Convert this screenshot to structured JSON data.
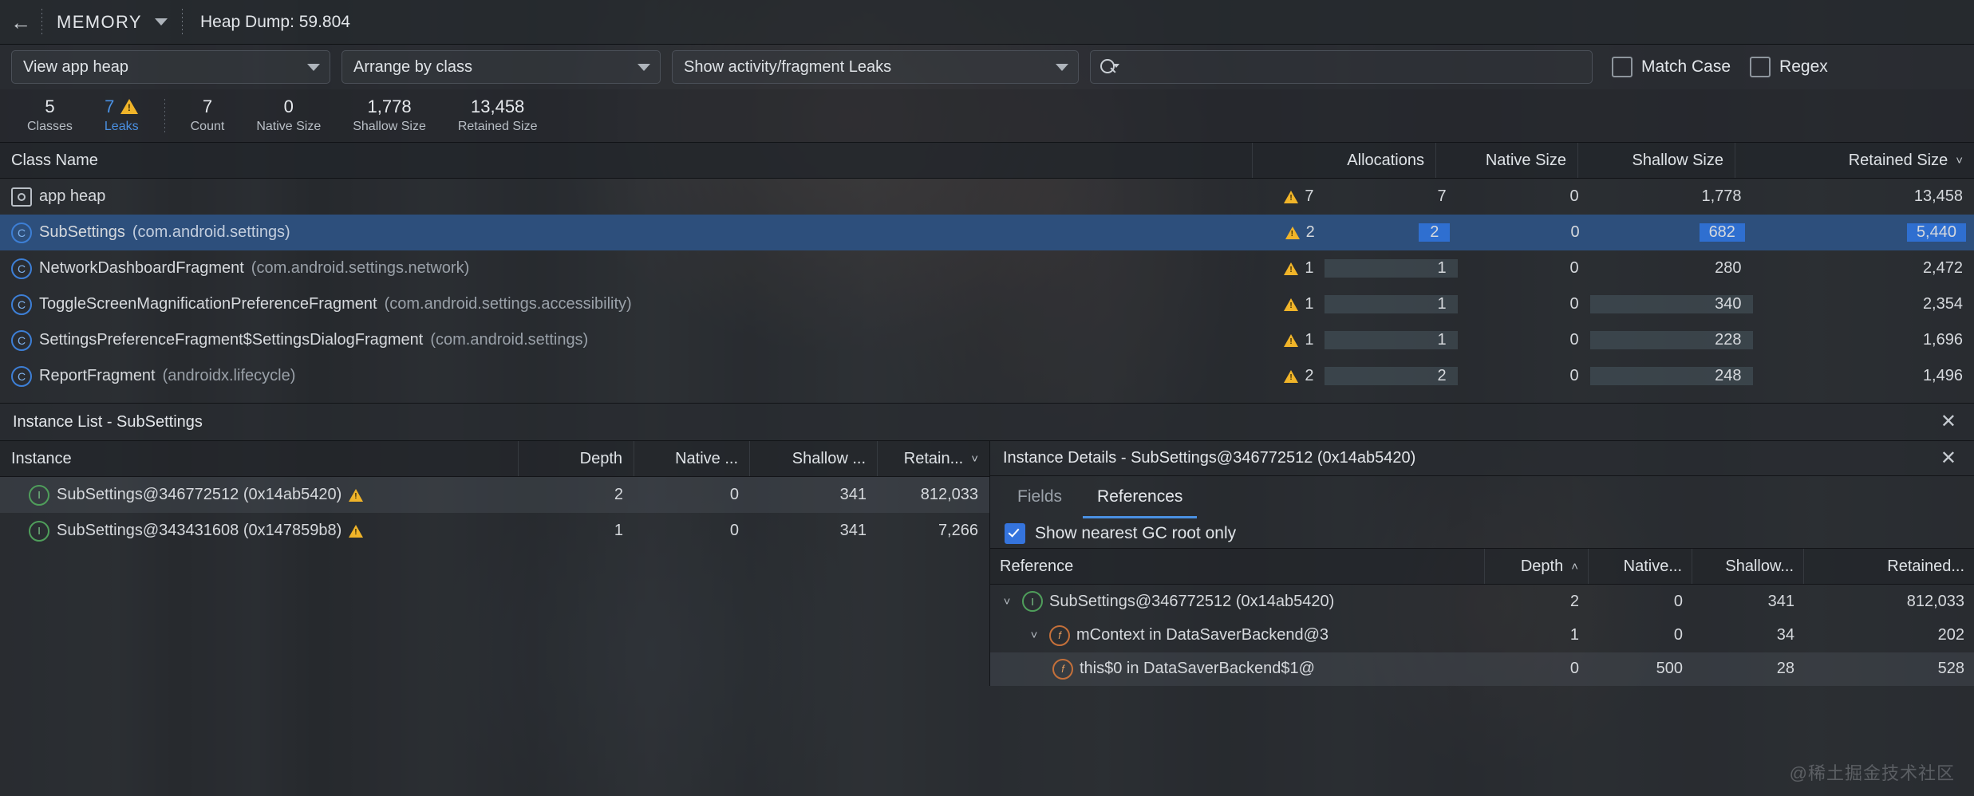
{
  "topbar": {
    "back_icon": "back-arrow-icon",
    "tool_name": "MEMORY",
    "dropdown_icon": "chevron-down-icon",
    "session_label": "Heap Dump: 59.804"
  },
  "filterbar": {
    "view_heap": "View app heap",
    "arrange_by": "Arrange by class",
    "leaks_filter": "Show activity/fragment Leaks",
    "search": {
      "value": "",
      "placeholder": "",
      "icon": "search-icon"
    },
    "match_case": {
      "label": "Match Case",
      "checked": false
    },
    "regex": {
      "label": "Regex",
      "checked": false
    }
  },
  "stats": [
    {
      "value": "5",
      "label": "Classes",
      "warn": false,
      "accent": false
    },
    {
      "value": "7",
      "label": "Leaks",
      "warn": true,
      "accent": true
    },
    {
      "value": "7",
      "label": "Count",
      "warn": false,
      "accent": false
    },
    {
      "value": "0",
      "label": "Native Size",
      "warn": false,
      "accent": false
    },
    {
      "value": "1,778",
      "label": "Shallow Size",
      "warn": false,
      "accent": false
    },
    {
      "value": "13,458",
      "label": "Retained Size",
      "warn": false,
      "accent": false
    }
  ],
  "class_table": {
    "columns": [
      "Class Name",
      "Allocations",
      "Native Size",
      "Shallow Size",
      "Retained Size"
    ],
    "sorted_column": "Retained Size",
    "sort_direction": "desc",
    "sort_icon": "chevron-down-icon",
    "rows": [
      {
        "icon": "folder-icon",
        "name": "app heap",
        "pkg": "",
        "leaks": "7",
        "allocations": "7",
        "native": "0",
        "shallow": "1,778",
        "retained": "13,458",
        "selected": false
      },
      {
        "icon": "class-icon",
        "name": "SubSettings",
        "pkg": "(com.android.settings)",
        "leaks": "2",
        "allocations": "2",
        "native": "0",
        "shallow": "682",
        "retained": "5,440",
        "selected": true
      },
      {
        "icon": "class-icon",
        "name": "NetworkDashboardFragment",
        "pkg": "(com.android.settings.network)",
        "leaks": "1",
        "allocations": "1",
        "native": "0",
        "shallow": "280",
        "retained": "2,472",
        "selected": false
      },
      {
        "icon": "class-icon",
        "name": "ToggleScreenMagnificationPreferenceFragment",
        "pkg": "(com.android.settings.accessibility)",
        "leaks": "1",
        "allocations": "1",
        "native": "0",
        "shallow": "340",
        "retained": "2,354",
        "selected": false
      },
      {
        "icon": "class-icon",
        "name": "SettingsPreferenceFragment$SettingsDialogFragment",
        "pkg": "(com.android.settings)",
        "leaks": "1",
        "allocations": "1",
        "native": "0",
        "shallow": "228",
        "retained": "1,696",
        "selected": false
      },
      {
        "icon": "class-icon",
        "name": "ReportFragment",
        "pkg": "(androidx.lifecycle)",
        "leaks": "2",
        "allocations": "2",
        "native": "0",
        "shallow": "248",
        "retained": "1,496",
        "selected": false
      }
    ]
  },
  "instance_list": {
    "title": "Instance List - SubSettings",
    "close_icon": "close-icon",
    "columns": [
      "Instance",
      "Depth",
      "Native ...",
      "Shallow ...",
      "Retain..."
    ],
    "sorted_column": "Retain...",
    "sort_icon": "chevron-down-icon",
    "rows": [
      {
        "icon": "instance-icon",
        "name": "SubSettings@346772512 (0x14ab5420)",
        "warn": true,
        "depth": "2",
        "native": "0",
        "shallow": "341",
        "retained": "812,033",
        "selected": true
      },
      {
        "icon": "instance-icon",
        "name": "SubSettings@343431608 (0x147859b8)",
        "warn": true,
        "depth": "1",
        "native": "0",
        "shallow": "341",
        "retained": "7,266",
        "selected": false
      }
    ]
  },
  "instance_details": {
    "title": "Instance Details - SubSettings@346772512 (0x14ab5420)",
    "close_icon": "close-icon",
    "tabs": [
      {
        "label": "Fields",
        "active": false
      },
      {
        "label": "References",
        "active": true
      }
    ],
    "gc_root_checkbox": {
      "label": "Show nearest GC root only",
      "checked": true
    },
    "columns": [
      "Reference",
      "Depth",
      "Native...",
      "Shallow...",
      "Retained..."
    ],
    "sorted_column": "Depth",
    "sort_icon": "chevron-up-icon",
    "rows": [
      {
        "indent": 0,
        "twisty": "expanded",
        "icon": "instance-icon",
        "name": "SubSettings@346772512 (0x14ab5420)",
        "depth": "2",
        "native": "0",
        "shallow": "341",
        "retained": "812,033",
        "selected": false
      },
      {
        "indent": 1,
        "twisty": "expanded",
        "icon": "field-icon",
        "name": "mContext in DataSaverBackend@3",
        "depth": "1",
        "native": "0",
        "shallow": "34",
        "retained": "202",
        "selected": false
      },
      {
        "indent": 2,
        "twisty": "none",
        "icon": "field-icon",
        "name": "this$0 in DataSaverBackend$1@",
        "depth": "0",
        "native": "500",
        "shallow": "28",
        "retained": "528",
        "selected": true
      }
    ]
  },
  "watermark": "@稀土掘金技术社区",
  "colors": {
    "accent_blue": "#4a90e2",
    "selection_blue": "#2d4f7c",
    "cell_highlight_blue": "#2f6fd0",
    "warning_yellow": "#f0b429",
    "background": "#2b2e33"
  }
}
